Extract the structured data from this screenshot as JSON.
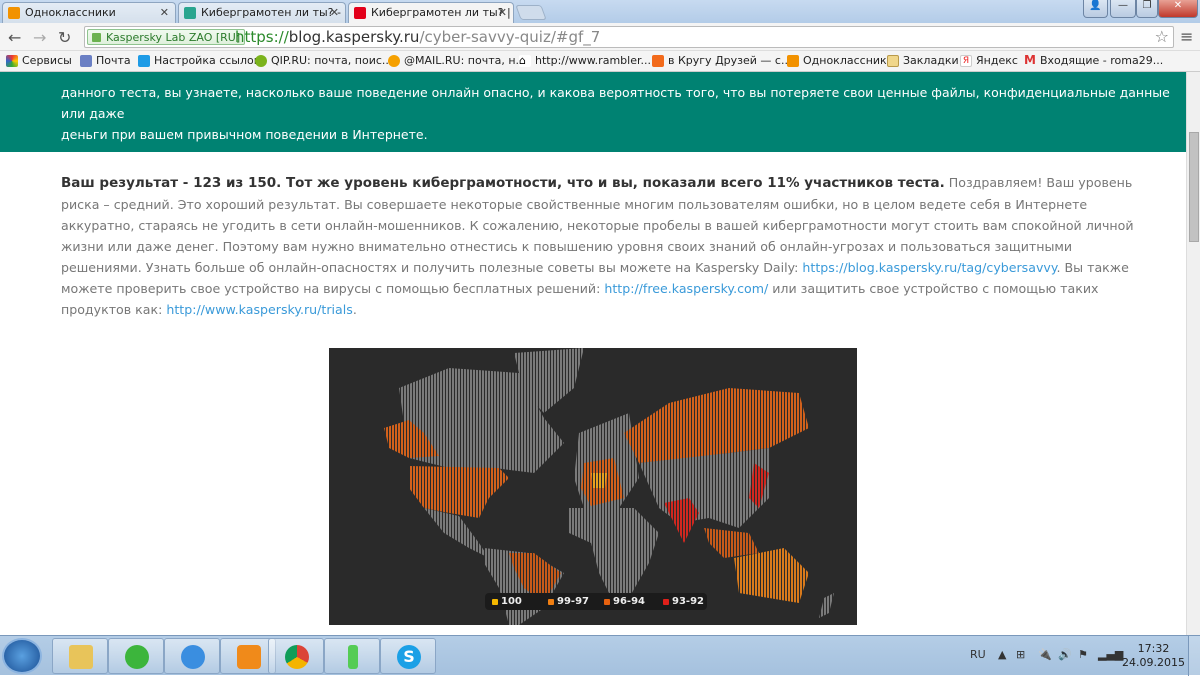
{
  "browser": {
    "tabs": [
      {
        "title": "Одноклассники",
        "icon": "odnoklassniki-icon"
      },
      {
        "title": "Киберграмотен ли ты? - К",
        "icon": "kaspersky-icon"
      },
      {
        "title": "Киберграмотен ли ты? | К",
        "icon": "kaspersky-icon",
        "active": true
      }
    ],
    "ev_badge": "Kaspersky Lab ZAO [RU]",
    "url": {
      "scheme": "https://",
      "host": "blog.kaspersky.ru",
      "path": "/cyber-savvy-quiz/#gf_7"
    },
    "bookmarks": [
      "Сервисы",
      "Почта",
      "Настройка ссылок",
      "QIP.RU: почта, поис...",
      "@MAIL.RU: почта, н...",
      "http://www.rambler....",
      "в Кругу Друзей — с...",
      "Одноклассники",
      "Закладки",
      "Яндекс",
      "Входящие - roma29..."
    ]
  },
  "page": {
    "banner_line1": "данного теста, вы узнаете, насколько ваше поведение онлайн опасно, и какова вероятность того, что вы потеряете свои ценные файлы, конфиденциальные данные или даже",
    "banner_line2": "деньги при вашем привычном поведении в Интернете.",
    "result_bold": "Ваш результат - 123 из 150. Тот же уровень киберграмотности, что и вы, показали всего 11% участников теста.",
    "result_text1": " Поздравляем! Ваш уровень риска – средний. Это хороший результат. Вы совершаете некоторые свойственные многим пользователям ошибки, но в целом ведете себя в Интернете аккуратно, стараясь не угодить в сети онлайн-мошенников. К сожалению, некоторые пробелы в вашей киберграмотности могут стоить вам спокойной личной жизни или даже денег. Поэтому вам нужно внимательно отнестись к повышению уровня своих знаний об онлайн-угрозах и пользоваться защитными решениями. Узнать больше об онлайн-опасностях и получить полезные советы вы можете на Kaspersky Daily: ",
    "link1": "https://blog.kaspersky.ru/tag/cybersavvy",
    "result_text2": ". Вы также можете проверить свое устройство на вирусы с помощью бесплатных решений: ",
    "link2": "http://free.kaspersky.com/",
    "result_text3": " или защитить свое устройство с помощью таких продуктов как: ",
    "link3": "http://www.kaspersky.ru/trials",
    "result_text4": ".",
    "map_legend": [
      {
        "label": "100",
        "color": "#f5b800"
      },
      {
        "label": "99-97",
        "color": "#f07f12"
      },
      {
        "label": "96-94",
        "color": "#e8620f"
      },
      {
        "label": "93-92",
        "color": "#e0201a"
      }
    ]
  },
  "taskbar": {
    "lang": "RU",
    "time": "17:32",
    "date": "24.09.2015"
  }
}
